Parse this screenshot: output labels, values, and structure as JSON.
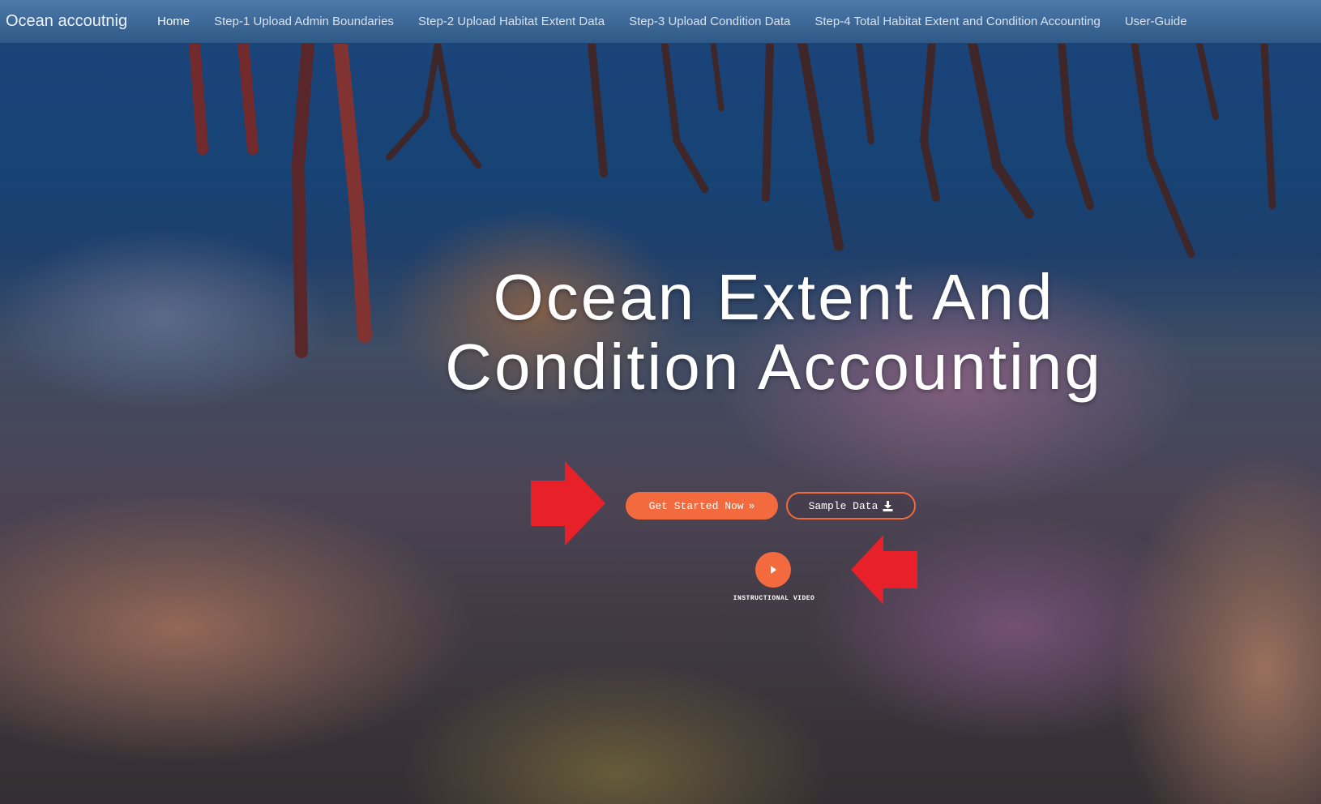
{
  "navbar": {
    "brand": "Ocean accoutnig",
    "items": [
      {
        "label": "Home",
        "active": true
      },
      {
        "label": "Step-1 Upload Admin Boundaries",
        "active": false
      },
      {
        "label": "Step-2 Upload Habitat Extent Data",
        "active": false
      },
      {
        "label": "Step-3 Upload Condition Data",
        "active": false
      },
      {
        "label": "Step-4 Total Habitat Extent and Condition Accounting",
        "active": false
      },
      {
        "label": "User-Guide",
        "active": false
      }
    ]
  },
  "hero": {
    "title_line1": "Ocean Extent And",
    "title_line2": "Condition Accounting",
    "primary_button": {
      "label": "Get Started Now",
      "icon": "double-chevron-right-icon"
    },
    "secondary_button": {
      "label": "Sample Data",
      "icon": "download-icon"
    },
    "video": {
      "label": "INSTRUCTIONAL VIDEO",
      "icon": "play-icon"
    }
  },
  "colors": {
    "accent": "#f26a3d",
    "navbar": "#3c6796",
    "annotation_arrow": "#e8202a"
  }
}
